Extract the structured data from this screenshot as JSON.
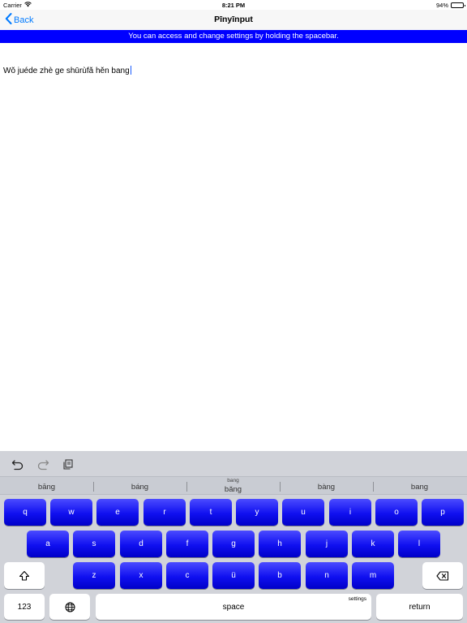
{
  "status_bar": {
    "carrier": "Carrier",
    "time": "8:21 PM",
    "battery": "94%",
    "battery_level": 0.94
  },
  "nav": {
    "back_label": "Back",
    "title": "Pīnyīnput"
  },
  "banner": {
    "text": "You can access and change settings by holding the spacebar."
  },
  "editor": {
    "text": "Wǒ juéde zhè ge shūrùfǎ hěn bang"
  },
  "shortcuts": [
    {
      "icon": "undo-icon"
    },
    {
      "icon": "redo-icon"
    },
    {
      "icon": "paste-icon"
    }
  ],
  "candidates": [
    {
      "label": "bāng",
      "sub": ""
    },
    {
      "label": "báng",
      "sub": ""
    },
    {
      "label": "bǎng",
      "sub": "bang"
    },
    {
      "label": "bàng",
      "sub": ""
    },
    {
      "label": "bang",
      "sub": ""
    }
  ],
  "keys": {
    "row1": [
      "q",
      "w",
      "e",
      "r",
      "t",
      "y",
      "u",
      "i",
      "o",
      "p"
    ],
    "row2": [
      "a",
      "s",
      "d",
      "f",
      "g",
      "h",
      "j",
      "k",
      "l"
    ],
    "row3": [
      "z",
      "x",
      "c",
      "ü",
      "b",
      "n",
      "m"
    ],
    "numbers": "123",
    "space": "space",
    "space_hint": "settings",
    "return": "return",
    "shift_icon": "shift-icon",
    "delete_icon": "delete-icon",
    "globe_icon": "globe-icon"
  },
  "colors": {
    "banner": "#0000ff",
    "key_blue": "#1010f0",
    "accent": "#007aff",
    "keyboard_bg": "#d1d3d9"
  }
}
